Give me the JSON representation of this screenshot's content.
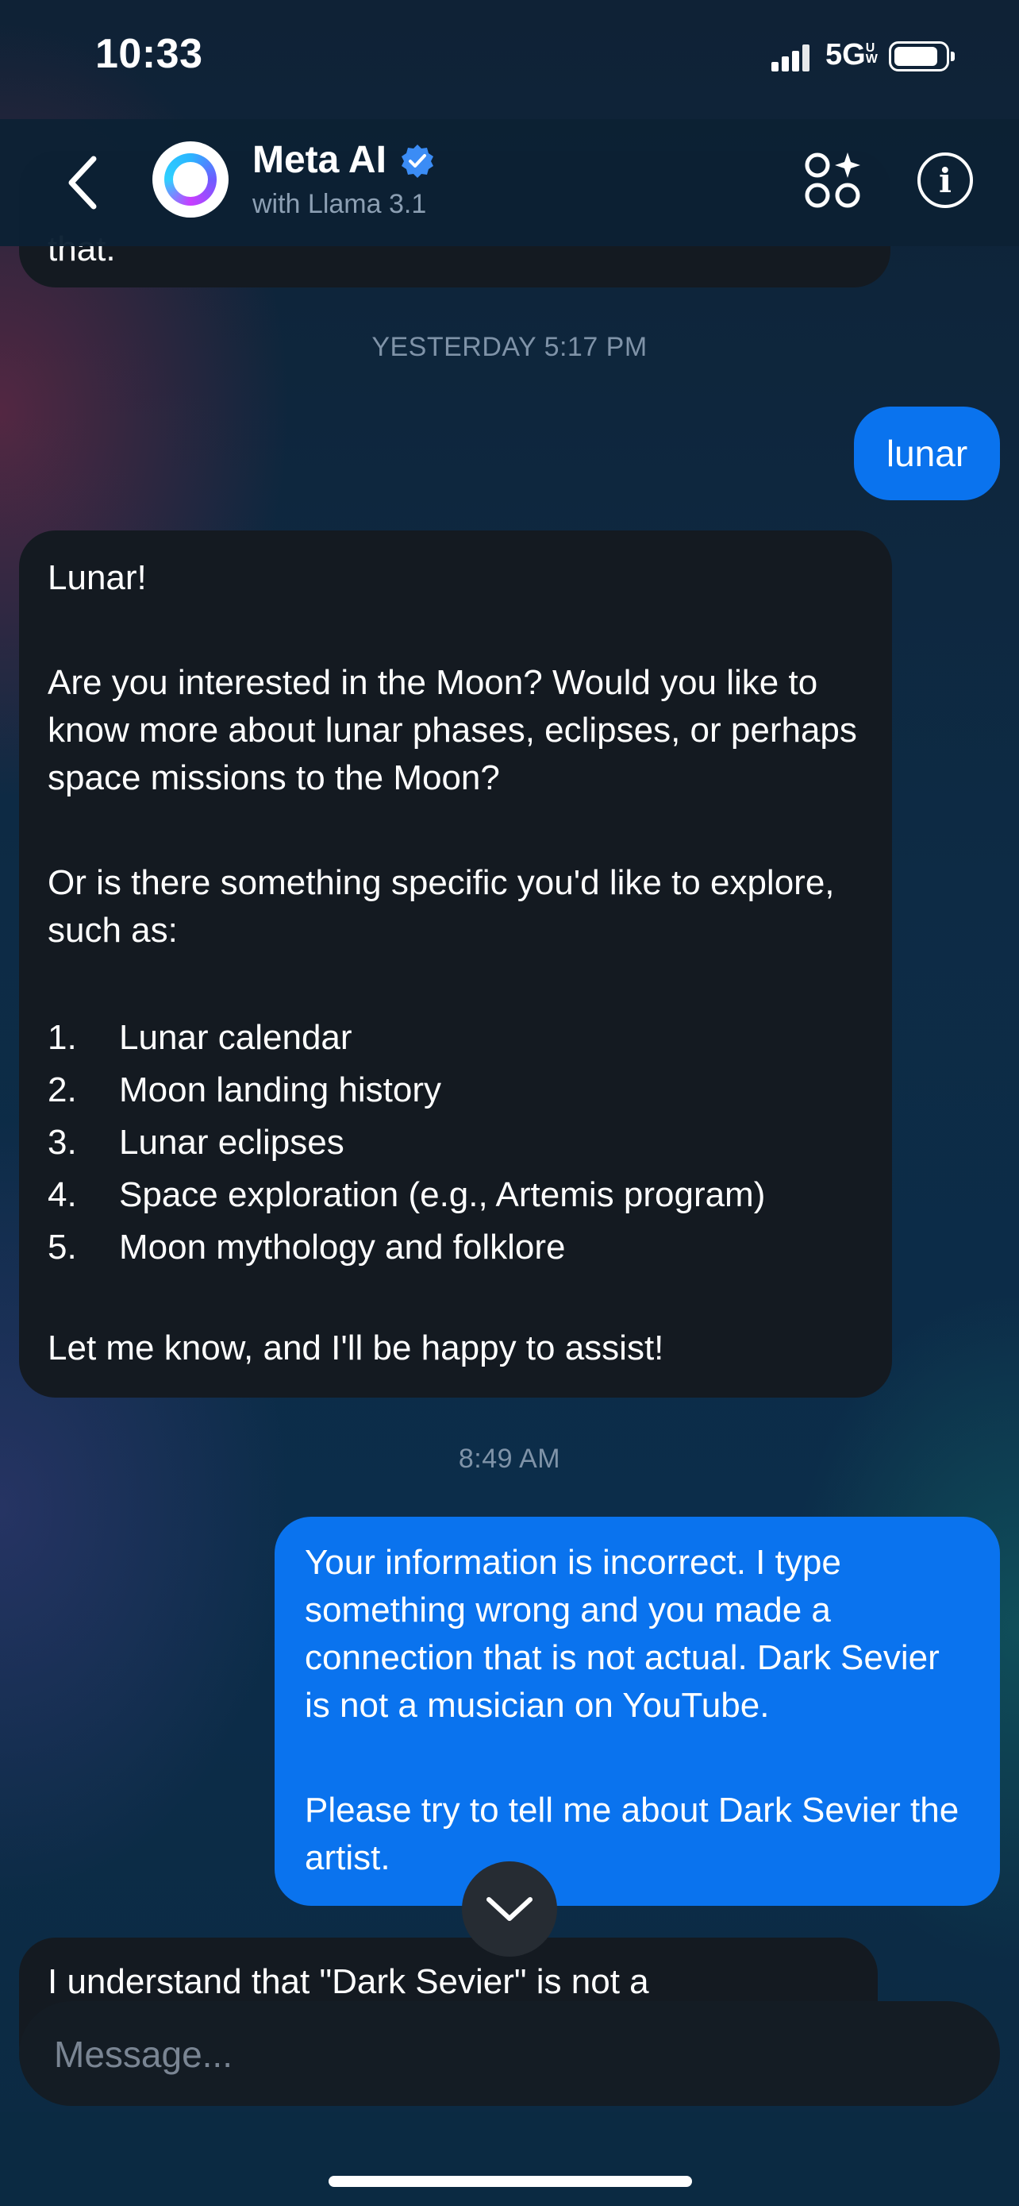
{
  "status_bar": {
    "time": "10:33",
    "network": "5G",
    "network_badge": "UW"
  },
  "header": {
    "name": "Meta AI",
    "subtitle": "with Llama 3.1"
  },
  "colors": {
    "user_bubble": "#0a73ee",
    "ai_bubble": "#141a21",
    "verified_badge": "#3b8cf5"
  },
  "messages": {
    "prev_fragment": "that.",
    "timestamp_1": "YESTERDAY 5:17 PM",
    "user_1": "lunar",
    "ai_1": {
      "p1": "Lunar!",
      "p2": "Are you interested in the Moon? Would you like to know more about lunar phases, eclipses, or perhaps space missions to the Moon?",
      "p3": "Or is there something specific you'd like to explore, such as:",
      "items": [
        {
          "num": "1.",
          "text": "Lunar calendar"
        },
        {
          "num": "2.",
          "text": "Moon landing history"
        },
        {
          "num": "3.",
          "text": "Lunar eclipses"
        },
        {
          "num": "4.",
          "text": "Space exploration (e.g., Artemis program)"
        },
        {
          "num": "5.",
          "text": "Moon mythology and folklore"
        }
      ],
      "p4": "Let me know, and I'll be happy to assist!"
    },
    "timestamp_2": "8:49 AM",
    "user_2": {
      "p1": "Your information is incorrect. I type something wrong and you made a connection that is not actual. Dark Sevier is not a musician on YouTube.",
      "p2": "Please try to tell me about Dark Sevier the artist."
    },
    "ai_2_partial": "I understand that \"Dark Sevier\" is not a"
  },
  "composer": {
    "placeholder": "Message..."
  }
}
